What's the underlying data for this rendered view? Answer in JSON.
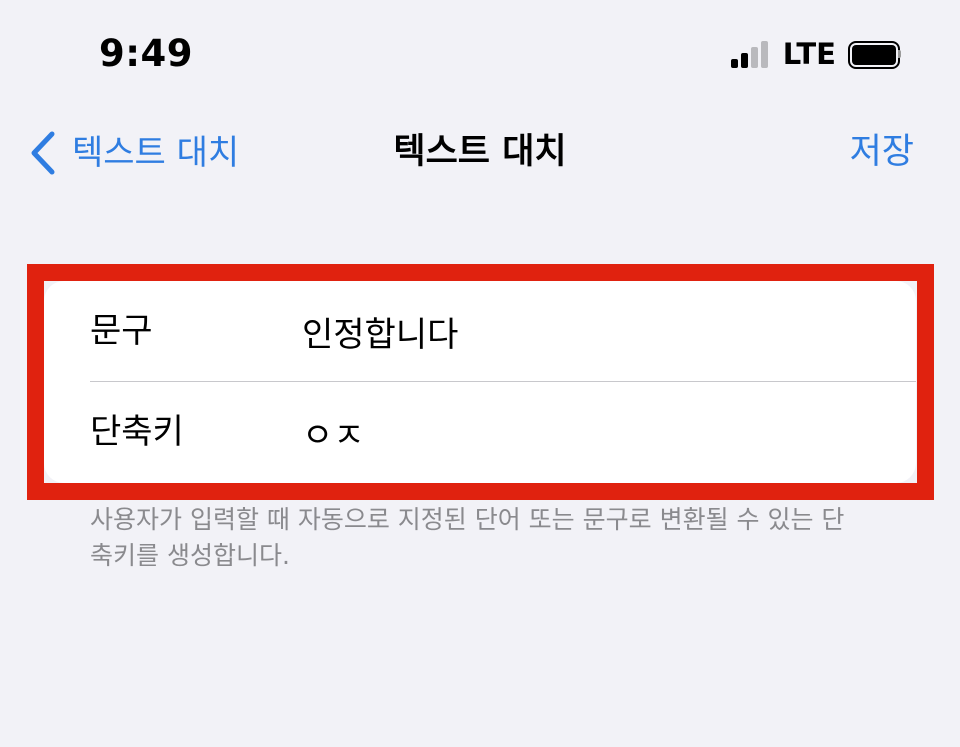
{
  "status_bar": {
    "time": "9:49",
    "network": "LTE",
    "signal_bars_active": 2,
    "signal_bars_total": 4
  },
  "nav": {
    "back_label": "텍스트 대치",
    "title": "텍스트 대치",
    "save_label": "저장"
  },
  "form": {
    "phrase_label": "문구",
    "phrase_value": "인정합니다",
    "shortcut_label": "단축키",
    "shortcut_value": "ㅇㅈ"
  },
  "footer_note": "사용자가 입력할 때 자동으로 지정된 단어 또는 문구로 변환될 수 있는 단축키를 생성합니다.",
  "colors": {
    "background": "#f2f2f7",
    "accent_blue": "#2f7de1",
    "highlight_red": "#e0220f",
    "signal_active": "#000000",
    "signal_inactive": "#b9b9bd"
  }
}
